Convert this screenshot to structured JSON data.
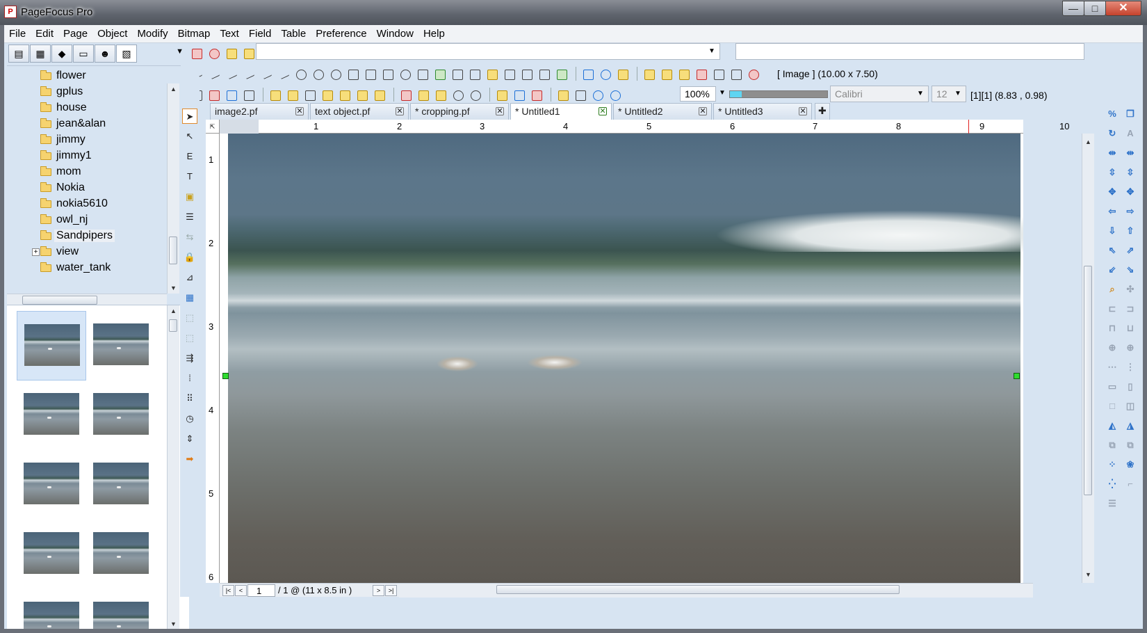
{
  "window": {
    "title": "PageFocus Pro",
    "minimize": "—",
    "maximize": "□",
    "close": "✕"
  },
  "menu": [
    "File",
    "Edit",
    "Page",
    "Object",
    "Modify",
    "Bitmap",
    "Text",
    "Field",
    "Table",
    "Preference",
    "Window",
    "Help"
  ],
  "tree": {
    "items": [
      {
        "label": "flower"
      },
      {
        "label": "gplus"
      },
      {
        "label": "house"
      },
      {
        "label": "jean&alan"
      },
      {
        "label": "jimmy"
      },
      {
        "label": "jimmy1"
      },
      {
        "label": "mom"
      },
      {
        "label": "Nokia"
      },
      {
        "label": "nokia5610"
      },
      {
        "label": "owl_nj"
      },
      {
        "label": "Sandpipers",
        "selected": true
      },
      {
        "label": "view",
        "expandable": true
      },
      {
        "label": "water_tank"
      }
    ]
  },
  "toolbar": {
    "object_info": "[ Image ]  (10.00  x  7.50)",
    "zoom": "100%",
    "font_name": "Calibri",
    "font_size": "12",
    "cursor_info": "[1][1]    (8.83  ,   0.98)"
  },
  "tabs": [
    {
      "label": "image2.pf"
    },
    {
      "label": "text object.pf"
    },
    {
      "label": "* cropping.pf"
    },
    {
      "label": "* Untitled1",
      "active": true
    },
    {
      "label": "* Untitled2"
    },
    {
      "label": "* Untitled3"
    }
  ],
  "ruler": {
    "h": [
      "1",
      "2",
      "3",
      "4",
      "5",
      "6",
      "7",
      "8",
      "9",
      "10"
    ],
    "v": [
      "1",
      "2",
      "3",
      "4",
      "5",
      "6"
    ]
  },
  "nav": {
    "page": "1",
    "info": "/ 1 @ (11 x 8.5 in )",
    "first": "|<",
    "prev": "<",
    "next": ">",
    "last": ">|"
  },
  "icons": {
    "folder": "folder-icon",
    "pointer": "pointer-icon",
    "text": "text-tool-icon"
  }
}
